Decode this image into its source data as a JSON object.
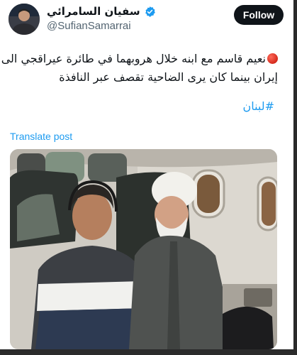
{
  "tweet": {
    "display_name": "سفيان السامرائي",
    "handle": "@SufianSamarrai",
    "follow_label": "Follow",
    "text_line_1": "نعيم قاسم مع ابنه خلال هروبهما في طائرة عيراقجي الى",
    "text_line_2": "إيران بينما كان يرى الضاحية تقصف عبر النافذة",
    "hashtag": "#لبنان",
    "translate_label": "Translate post"
  },
  "colors": {
    "accent": "#1d9bf0",
    "text": "#0f1419",
    "muted": "#536471",
    "follow_bg": "#0f1419"
  },
  "icons": {
    "verified": "verified-badge-icon",
    "red_circle": "red-circle-emoji"
  }
}
